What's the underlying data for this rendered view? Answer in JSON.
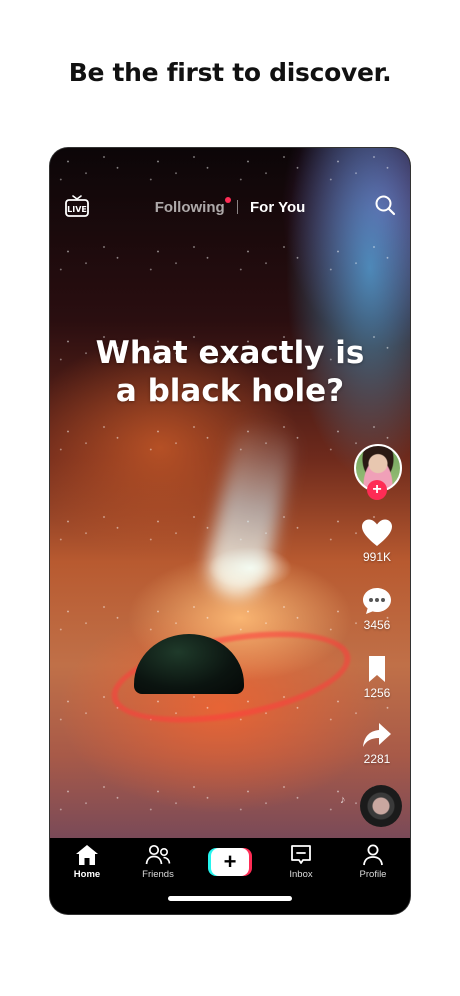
{
  "headline": "Be the first to discover.",
  "topbar": {
    "live_icon": "live-tv-icon",
    "live_label": "LIVE",
    "tabs": [
      {
        "label": "Following",
        "has_notification_dot": true
      },
      {
        "label": "For You",
        "selected": true
      }
    ],
    "search_icon": "search-icon"
  },
  "video": {
    "caption_line1": "What exactly is",
    "caption_line2": "a black hole?"
  },
  "actions": {
    "creator_avatar": "creator-avatar",
    "follow_icon": "plus-icon",
    "like": {
      "icon": "heart-icon",
      "count": "991K"
    },
    "comment": {
      "icon": "comment-bubble-icon",
      "count": "3456"
    },
    "save": {
      "icon": "bookmark-icon",
      "count": "1256"
    },
    "share": {
      "icon": "share-arrow-icon",
      "count": "2281"
    },
    "music_icon": "music-disc-icon"
  },
  "navbar": {
    "items": [
      {
        "label": "Home",
        "icon": "home-icon",
        "active": true
      },
      {
        "label": "Friends",
        "icon": "friends-icon"
      },
      {
        "label": "",
        "icon": "create-plus-icon"
      },
      {
        "label": "Inbox",
        "icon": "inbox-icon"
      },
      {
        "label": "Profile",
        "icon": "profile-icon"
      }
    ]
  },
  "colors": {
    "accent_red": "#fe2c55",
    "accent_cyan": "#25f4ee",
    "nav_background": "#000000",
    "page_background": "#ffffff"
  }
}
